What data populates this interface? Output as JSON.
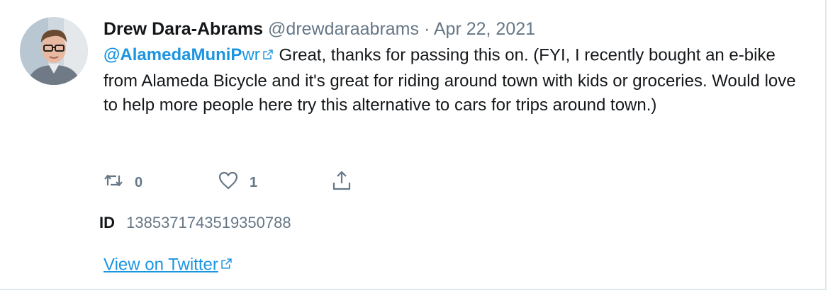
{
  "tweet": {
    "author_name": "Drew Dara-Abrams",
    "author_handle": "@drewdaraabrams",
    "separator": "·",
    "date": "Apr 22, 2021",
    "mention_bold": "@AlamedaMuniP",
    "mention_rest": "wr",
    "text": "Great, thanks for passing this on. (FYI, I recently bought an e-bike from Alameda Bicycle and it's great for riding around town with kids or groceries. Would love to help more people here try this alternative to cars for trips around town.)",
    "retweet_count": "0",
    "like_count": "1"
  },
  "meta": {
    "id_label": "ID",
    "id_value": "1385371743519350788"
  },
  "links": {
    "view_on_twitter": "View on Twitter"
  },
  "icons": {
    "retweet": "retweet-icon",
    "like": "heart-icon",
    "share": "share-icon",
    "external": "external-link-icon"
  },
  "colors": {
    "link": "#1b95e0",
    "muted": "#657786",
    "text": "#14171a"
  }
}
